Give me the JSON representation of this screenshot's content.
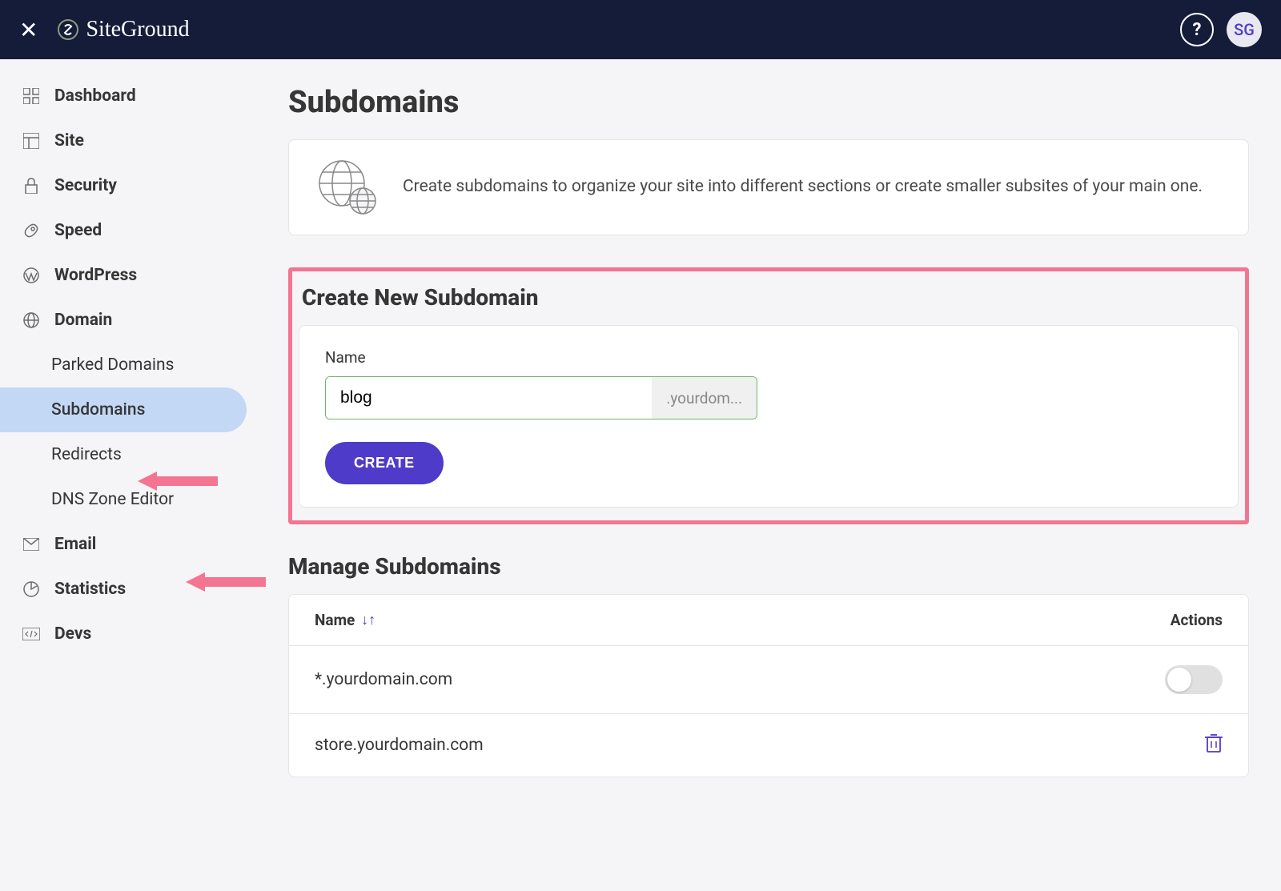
{
  "header": {
    "brand": "SiteGround",
    "avatar_initials": "SG"
  },
  "sidebar": {
    "items": [
      {
        "label": "Dashboard"
      },
      {
        "label": "Site"
      },
      {
        "label": "Security"
      },
      {
        "label": "Speed"
      },
      {
        "label": "WordPress"
      },
      {
        "label": "Domain"
      },
      {
        "label": "Email"
      },
      {
        "label": "Statistics"
      },
      {
        "label": "Devs"
      }
    ],
    "domain_subitems": [
      {
        "label": "Parked Domains"
      },
      {
        "label": "Subdomains"
      },
      {
        "label": "Redirects"
      },
      {
        "label": "DNS Zone Editor"
      }
    ]
  },
  "main": {
    "title": "Subdomains",
    "intro": "Create subdomains to organize your site into different sections or create smaller subsites of your main one.",
    "create": {
      "heading": "Create New Subdomain",
      "name_label": "Name",
      "name_value": "blog",
      "suffix": ".yourdom...",
      "button": "CREATE"
    },
    "manage": {
      "heading": "Manage Subdomains",
      "col_name": "Name",
      "col_actions": "Actions",
      "rows": [
        {
          "name": "*.yourdomain.com",
          "has_toggle": true
        },
        {
          "name": "store.yourdomain.com",
          "has_trash": true
        }
      ]
    }
  },
  "colors": {
    "accent": "#4f3bc9",
    "highlight_border": "#f47591",
    "input_border": "#6cb86c",
    "header_bg": "#141c3a"
  }
}
